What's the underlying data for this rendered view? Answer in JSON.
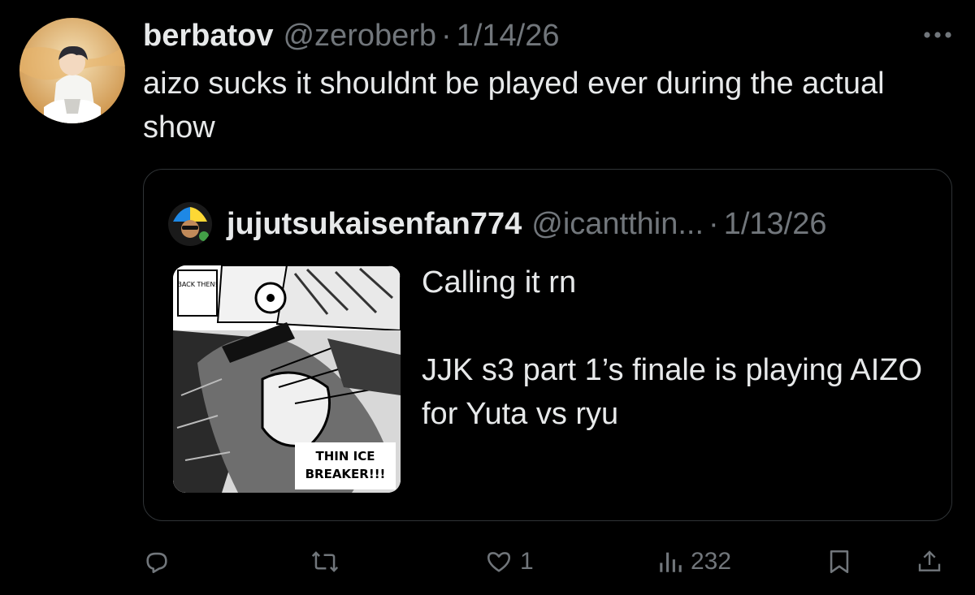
{
  "tweet": {
    "author_name": "berbatov",
    "author_handle": "@zeroberb",
    "separator": "·",
    "date": "1/14/26",
    "text": "aizo sucks it shouldnt be played ever during the actual show"
  },
  "quoted_tweet": {
    "author_name": "jujutsukaisenfan774",
    "author_handle": "@icantthin...",
    "separator": "·",
    "date": "1/13/26",
    "text_line1": "Calling it rn",
    "text_line2": "JJK s3 part 1’s finale is playing AIZO for Yuta vs ryu",
    "media": {
      "caption_top": "BACK THEN!",
      "caption_bottom_1": "THIN ICE",
      "caption_bottom_2": "BREAKER!!!"
    }
  },
  "actions": {
    "reply": {
      "icon": "reply-icon",
      "count": ""
    },
    "repost": {
      "icon": "repost-icon",
      "count": ""
    },
    "like": {
      "icon": "heart-icon",
      "count": "1"
    },
    "views": {
      "icon": "views-icon",
      "count": "232"
    },
    "bookmark": {
      "icon": "bookmark-icon"
    },
    "share": {
      "icon": "share-icon"
    }
  },
  "colors": {
    "background": "#000000",
    "primary_text": "#e7e9ea",
    "secondary_text": "#71767b",
    "border": "#2f3336"
  }
}
